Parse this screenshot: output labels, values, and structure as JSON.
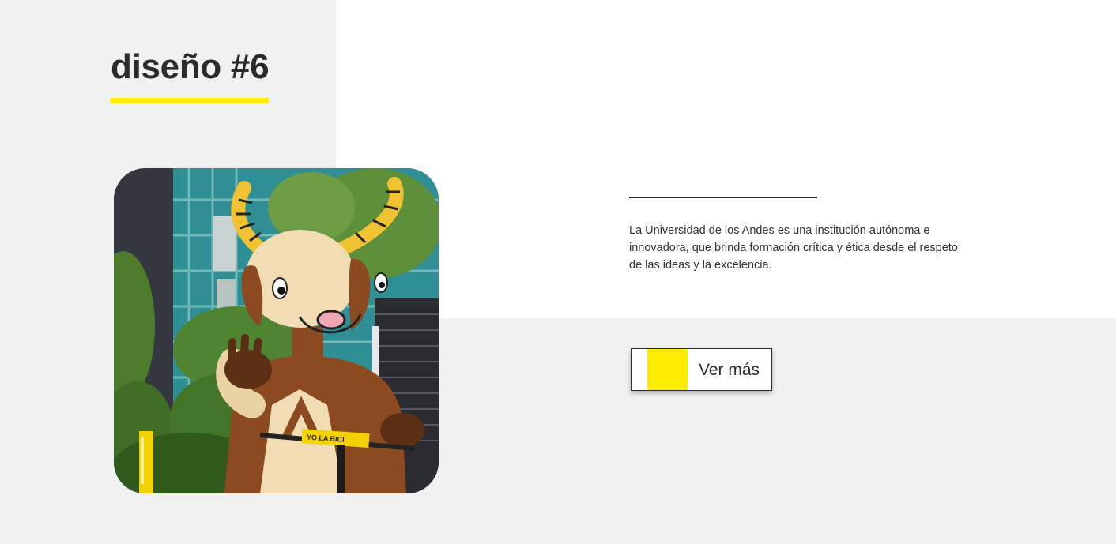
{
  "section": {
    "title": "diseño #6",
    "description": "La Universidad de los Andes es una institución autónoma e innovadora, que brinda formación crítica y ética desde el respeto de las ideas y la excelencia.",
    "cta_label": "Ver más"
  },
  "photo": {
    "subject": "mascot-photo",
    "sign_text": "YO LA BICI"
  },
  "colors": {
    "accent_yellow": "#ffed00",
    "text_dark": "#2b2b2b",
    "background_gray": "#f1f1f1",
    "panel_white": "#ffffff"
  }
}
